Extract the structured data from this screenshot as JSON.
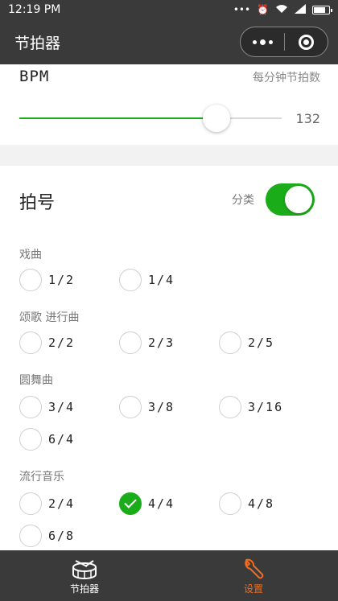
{
  "status": {
    "time": "12:19 PM",
    "icons": [
      "more-dots",
      "alarm-icon",
      "wifi-icon",
      "signal-icon",
      "battery-icon"
    ]
  },
  "nav": {
    "title": "节拍器"
  },
  "bpm": {
    "label": "BPM",
    "sublabel": "每分钟节拍数",
    "value": "132",
    "slider_fraction": 0.75
  },
  "signature": {
    "title": "拍号",
    "toggle_label": "分类",
    "toggle_on": true,
    "groups": [
      {
        "label": "戏曲",
        "options": [
          "1/2",
          "1/4"
        ]
      },
      {
        "label": "颂歌  进行曲",
        "options": [
          "2/2",
          "2/3",
          "2/5"
        ]
      },
      {
        "label": "圆舞曲",
        "options": [
          "3/4",
          "3/8",
          "3/16",
          "6/4"
        ]
      },
      {
        "label": "流行音乐",
        "options": [
          "2/4",
          "4/4",
          "4/8",
          "6/8"
        ]
      }
    ],
    "selected": "4/4"
  },
  "tabbar": {
    "items": [
      {
        "label": "节拍器",
        "icon": "drum-icon"
      },
      {
        "label": "设置",
        "icon": "wrench-icon",
        "active": true
      }
    ]
  },
  "colors": {
    "accent": "#1aad19",
    "tab_active": "#f26b1d",
    "bar": "#3a3a3a"
  }
}
